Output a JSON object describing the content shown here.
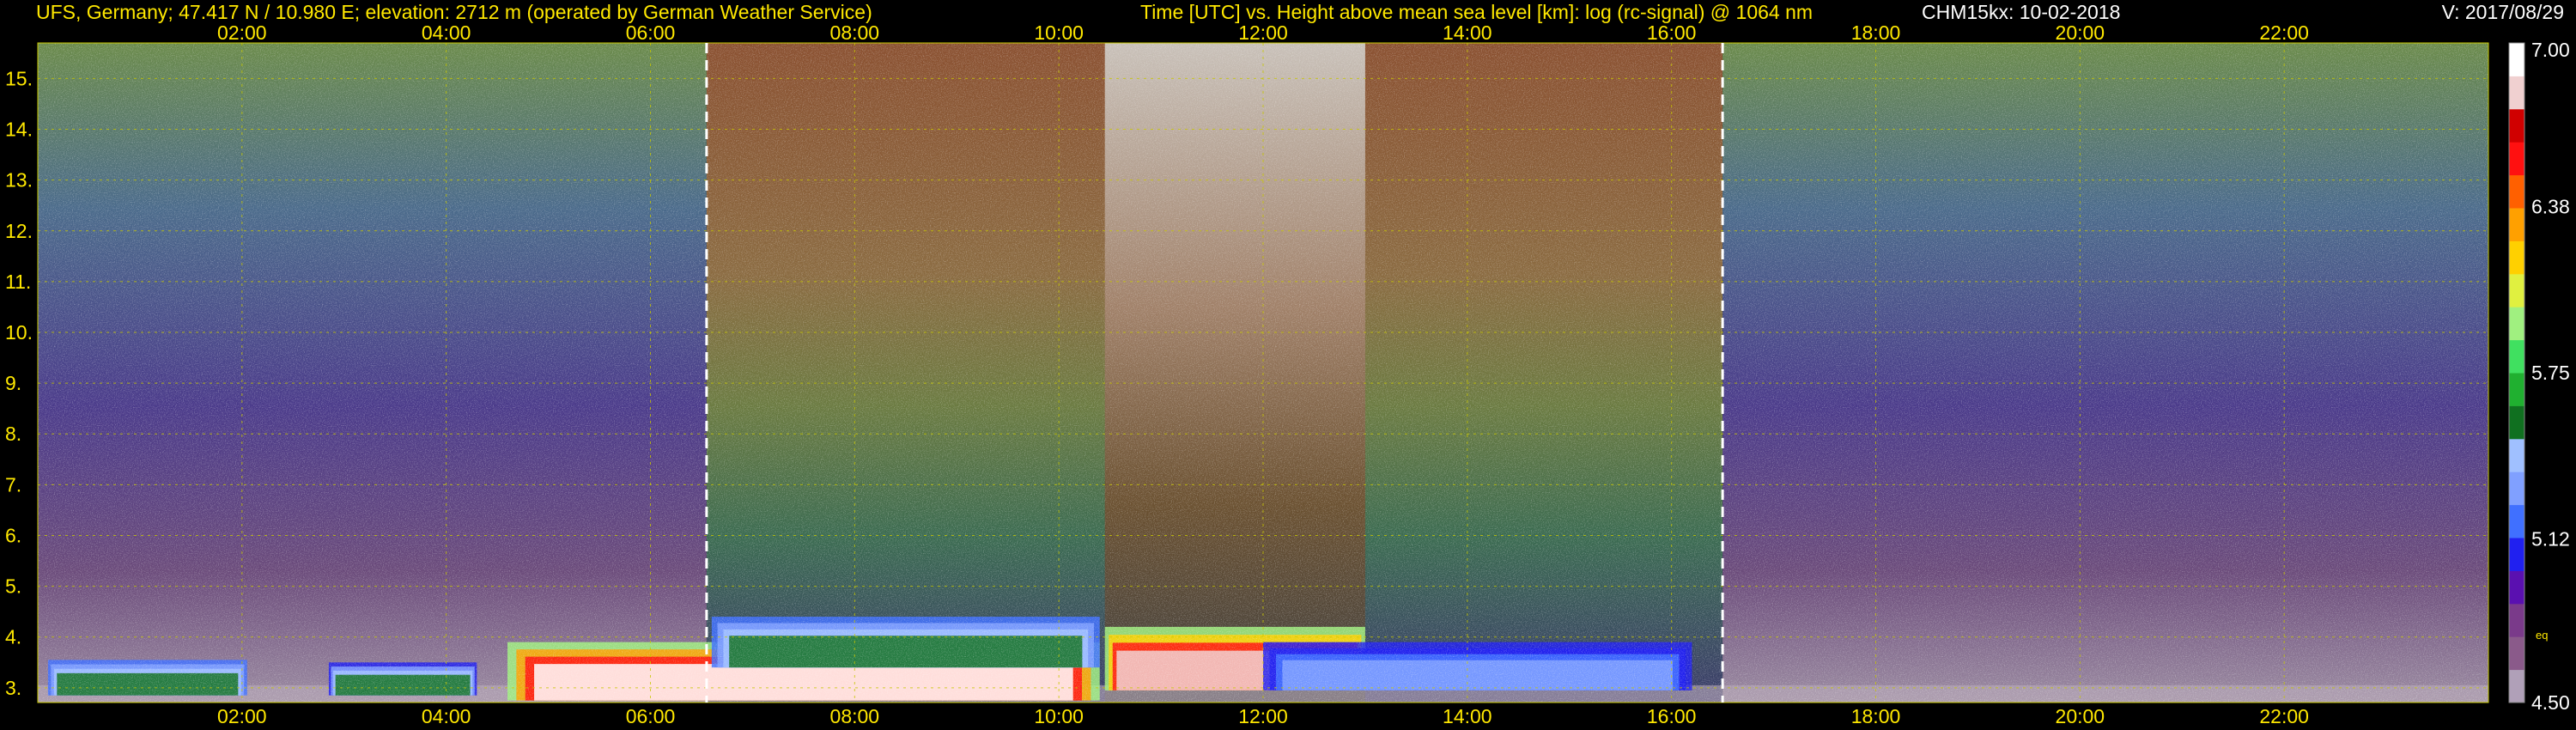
{
  "header": {
    "station": "UFS, Germany; 47.417 N / 10.980 E; elevation: 2712 m  (operated by German Weather Service)",
    "axis_description": "Time [UTC] vs. Height above mean sea level [km]: log (rc-signal) @ 1064 nm",
    "instrument": "CHM15kx: 10-02-2018",
    "version": "V: 2017/08/29"
  },
  "colors": {
    "tick_text": "#ffe800",
    "grid": "#c8c800",
    "night_bg": "#5a4a8a",
    "day_bg": "#8a6a40"
  },
  "chart_data": {
    "type": "heatmap",
    "title": "Time [UTC] vs. Height above mean sea level [km]: log (rc-signal) @ 1064 nm",
    "xlabel": "Time [UTC]",
    "ylabel": "Height above mean sea level [km]",
    "xlim": [
      0.0,
      24.0
    ],
    "ylim": [
      2.71,
      15.7
    ],
    "x_ticks": [
      "02:00",
      "04:00",
      "06:00",
      "08:00",
      "10:00",
      "12:00",
      "14:00",
      "16:00",
      "18:00",
      "20:00",
      "22:00"
    ],
    "x_tick_values": [
      2,
      4,
      6,
      8,
      10,
      12,
      14,
      16,
      18,
      20,
      22
    ],
    "y_ticks": [
      "3.",
      "4.",
      "5.",
      "6.",
      "7.",
      "8.",
      "9.",
      "10.",
      "11.",
      "12.",
      "13.",
      "14.",
      "15."
    ],
    "y_tick_values": [
      3,
      4,
      5,
      6,
      7,
      8,
      9,
      10,
      11,
      12,
      13,
      14,
      15
    ],
    "grid": true,
    "sunrise_sunset_hours": [
      6.55,
      16.5
    ],
    "colorbar": {
      "min": 4.5,
      "max": 7.0,
      "labels": [
        "7.00",
        "6.38",
        "5.75",
        "5.12",
        "4.50"
      ],
      "label_values": [
        7.0,
        6.38,
        5.75,
        5.12,
        4.5
      ],
      "note": "eq",
      "colors": [
        "#b0a0b8",
        "#8a5a8a",
        "#7a3a8a",
        "#5a10b0",
        "#2020f0",
        "#4070ff",
        "#80a0ff",
        "#a0c0ff",
        "#107020",
        "#20b030",
        "#40e060",
        "#a0f080",
        "#e0f040",
        "#ffd000",
        "#ffa000",
        "#ff6000",
        "#ff1010",
        "#d00000",
        "#f0d0d0",
        "#ffffff"
      ]
    },
    "aerosol_layers": [
      {
        "t0": 0.1,
        "t1": 2.05,
        "h0": 2.85,
        "h1": 3.55,
        "peak": 5.6
      },
      {
        "t0": 2.85,
        "t1": 4.3,
        "h0": 2.85,
        "h1": 3.5,
        "peak": 5.5
      },
      {
        "t0": 4.6,
        "t1": 10.4,
        "h0": 2.75,
        "h1": 3.9,
        "peak": 7.0
      },
      {
        "t0": 6.6,
        "t1": 10.4,
        "h0": 3.4,
        "h1": 4.4,
        "peak": 5.6
      },
      {
        "t0": 10.45,
        "t1": 13.0,
        "h0": 2.95,
        "h1": 4.2,
        "peak": 6.9
      },
      {
        "t0": 12.0,
        "t1": 16.2,
        "h0": 2.95,
        "h1": 3.9,
        "peak": 5.3
      }
    ]
  }
}
